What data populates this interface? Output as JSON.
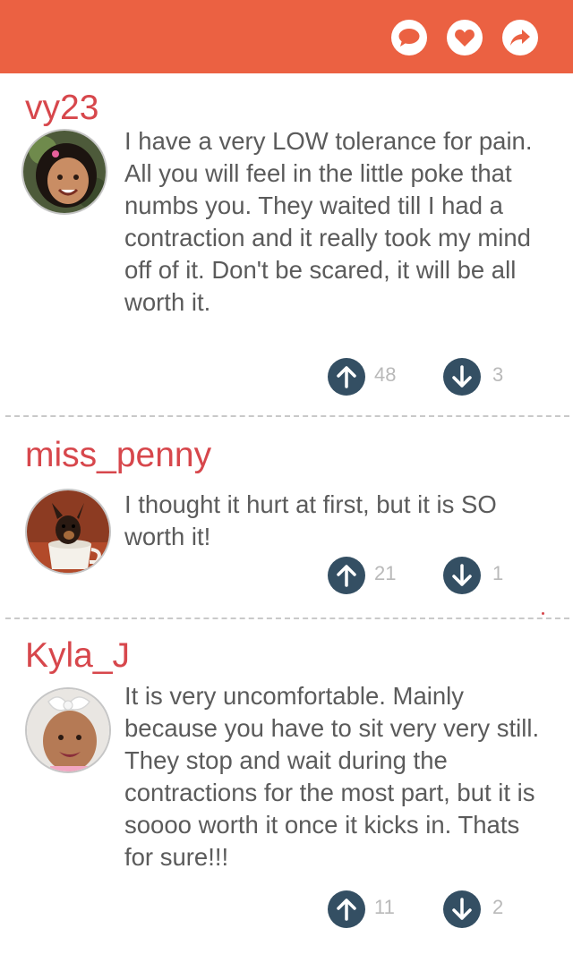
{
  "header": {
    "actions": [
      {
        "icon": "comment-icon",
        "label": "comment"
      },
      {
        "icon": "heart-icon",
        "label": "like"
      },
      {
        "icon": "share-icon",
        "label": "share"
      }
    ]
  },
  "comments": [
    {
      "username": "vy23",
      "avatar_icon": "baby-girl-avatar",
      "text": "I have a very LOW tolerance for pain. All you will feel in the little poke that numbs you. They waited till I had a contraction and it really took my mind off of it. Don't be scared, it will be all worth it.",
      "upvotes": "48",
      "downvotes": "3"
    },
    {
      "username": "miss_penny",
      "avatar_icon": "puppy-in-teacup-avatar",
      "text": "I thought it hurt at first, but it is SO worth it!",
      "upvotes": "21",
      "downvotes": "1"
    },
    {
      "username": "Kyla_J",
      "avatar_icon": "baby-with-bow-avatar",
      "text": "It is very uncomfortable. Mainly because you have to sit very very still. They stop and wait during the contractions for the most part, but it is soooo worth it once it kicks in. Thats for sure!!!",
      "upvotes": "11",
      "downvotes": "2"
    }
  ],
  "colors": {
    "header": "#eb6142",
    "username": "#d7474c",
    "body_text": "#5b5b5b",
    "vote_button": "#344f63",
    "vote_count": "#b9b9b9"
  }
}
